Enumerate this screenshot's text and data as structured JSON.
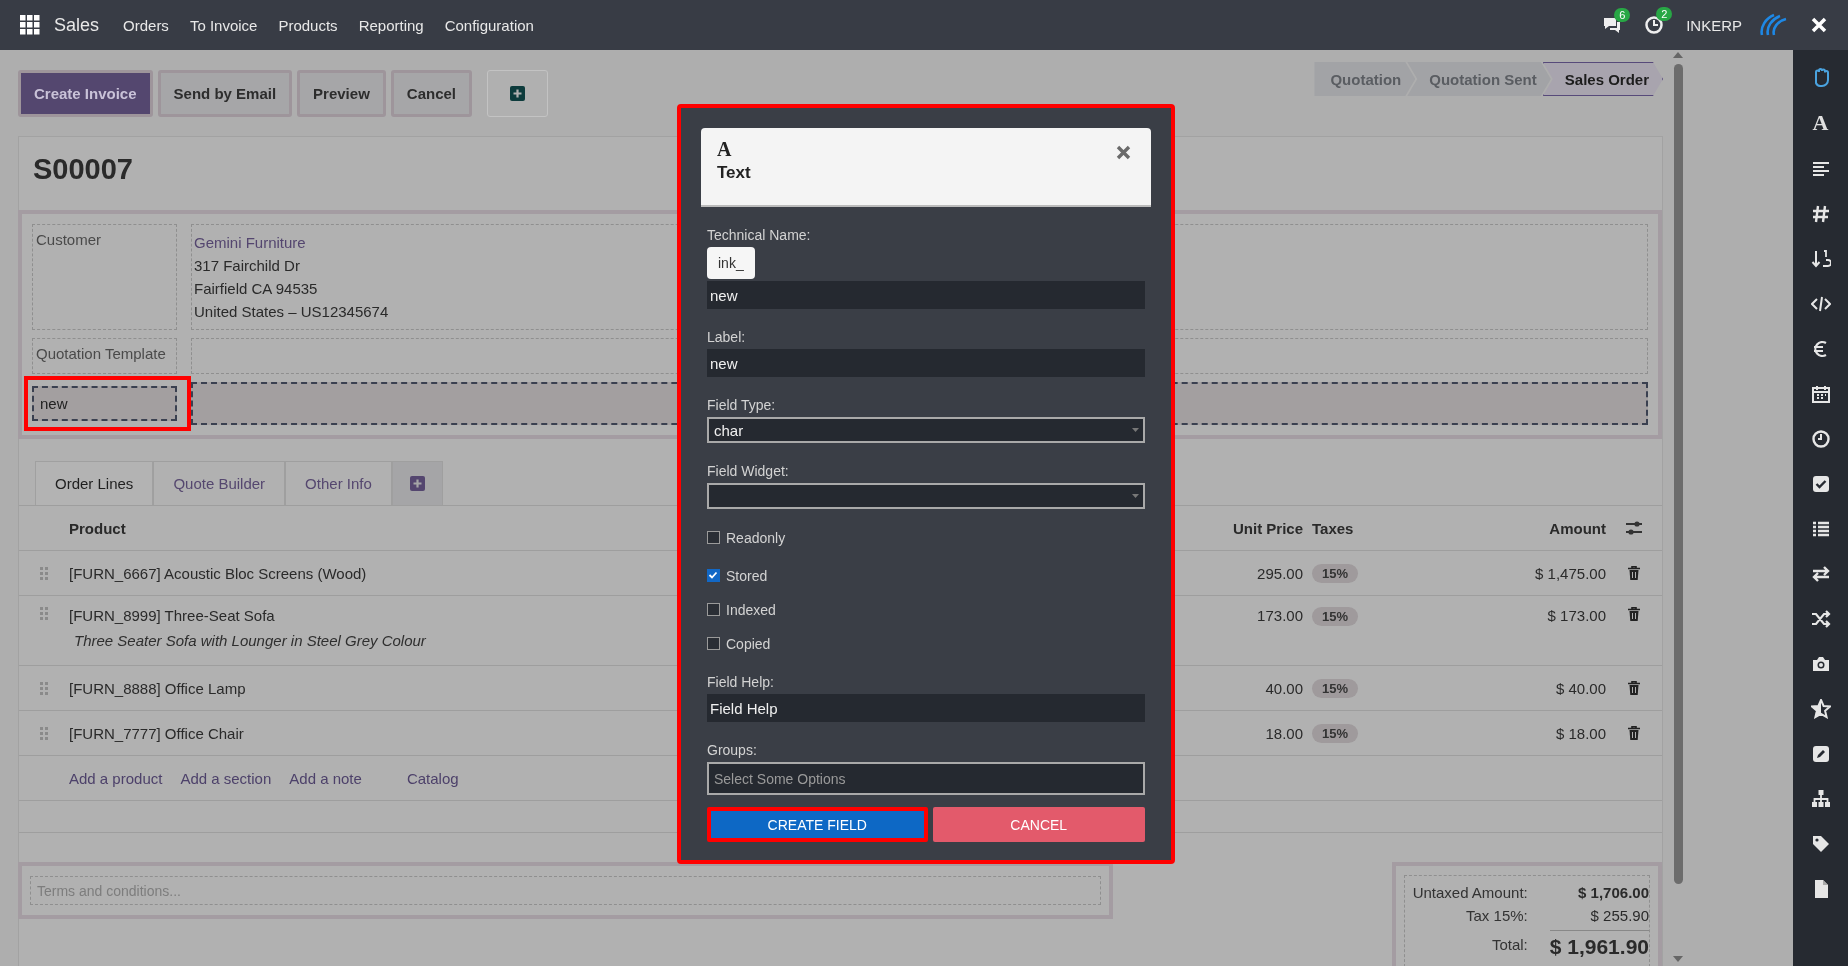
{
  "navbar": {
    "app": "Sales",
    "menu": [
      "Orders",
      "To Invoice",
      "Products",
      "Reporting",
      "Configuration"
    ],
    "messages_count": "6",
    "activities_count": "2",
    "company": "INKERP"
  },
  "actions": [
    {
      "label": "Create Invoice",
      "kind": "primary"
    },
    {
      "label": "Send by Email",
      "kind": "secondary"
    },
    {
      "label": "Preview",
      "kind": "secondary"
    },
    {
      "label": "Cancel",
      "kind": "secondary"
    },
    {
      "kind": "add"
    }
  ],
  "statusbar": [
    {
      "label": "Quotation",
      "selected": false
    },
    {
      "label": "Quotation Sent",
      "selected": false
    },
    {
      "label": "Sales Order",
      "selected": true
    }
  ],
  "record": {
    "name": "S00007",
    "customer_label": "Customer",
    "customer_name": "Gemini Furniture",
    "address_lines": [
      "317 Fairchild Dr",
      "Fairfield CA 94535",
      "United States – US12345674"
    ],
    "template_label": "Quotation Template",
    "new_field": {
      "label": "new",
      "highlighted": true
    }
  },
  "tabs": [
    {
      "label": "Order Lines",
      "selected": true
    },
    {
      "label": "Quote Builder",
      "selected": false
    },
    {
      "label": "Other Info",
      "selected": false
    }
  ],
  "table": {
    "columns": [
      "Product",
      "Unit Price",
      "Taxes",
      "Amount"
    ],
    "rows": [
      {
        "product": "[FURN_6667] Acoustic Bloc Screens (Wood)",
        "unit_price": "295.00",
        "tax": "15%",
        "amount": "$ 1,475.00"
      },
      {
        "product": "[FURN_8999] Three-Seat Sofa",
        "description": "Three Seater Sofa with Lounger in Steel Grey Colour",
        "unit_price": "173.00",
        "tax": "15%",
        "amount": "$ 173.00"
      },
      {
        "product": "[FURN_8888] Office Lamp",
        "unit_price": "40.00",
        "tax": "15%",
        "amount": "$ 40.00"
      },
      {
        "product": "[FURN_7777] Office Chair",
        "unit_price": "18.00",
        "tax": "15%",
        "amount": "$ 18.00"
      }
    ],
    "add_links": [
      "Add a product",
      "Add a section",
      "Add a note",
      "Catalog"
    ]
  },
  "terms_placeholder": "Terms and conditions...",
  "totals": [
    {
      "label": "Untaxed Amount:",
      "value": "$ 1,706.00",
      "kind": "subtotal"
    },
    {
      "label": "Tax 15%:",
      "value": "$ 255.90",
      "kind": "tax"
    },
    {
      "label": "Total:",
      "value": "$ 1,961.90",
      "kind": "total"
    }
  ],
  "sidebar": {
    "letter_icon": "A"
  },
  "dialog": {
    "highlighted": true,
    "icon": "A",
    "title": "Text",
    "fields": [
      {
        "kind": "prefixed",
        "label": "Technical Name:",
        "prefix": "ink_",
        "value": "new"
      },
      {
        "kind": "text",
        "label": "Label:",
        "value": "new"
      },
      {
        "kind": "select",
        "label": "Field Type:",
        "value": "char"
      },
      {
        "kind": "select",
        "label": "Field Widget:"
      },
      {
        "kind": "checkbox",
        "label": "Readonly",
        "checked": false
      },
      {
        "kind": "checkbox",
        "label": "Stored",
        "checked": true
      },
      {
        "kind": "checkbox",
        "label": "Indexed",
        "checked": false
      },
      {
        "kind": "checkbox",
        "label": "Copied",
        "checked": false
      },
      {
        "kind": "text",
        "label": "Field Help:",
        "value": "Field Help"
      },
      {
        "kind": "multiselect",
        "label": "Groups:",
        "placeholder": "Select Some Options"
      }
    ],
    "buttons": [
      {
        "label": "CREATE FIELD",
        "kind": "primary",
        "highlighted": true
      },
      {
        "label": "CANCEL",
        "kind": "danger",
        "highlighted": false
      }
    ]
  }
}
